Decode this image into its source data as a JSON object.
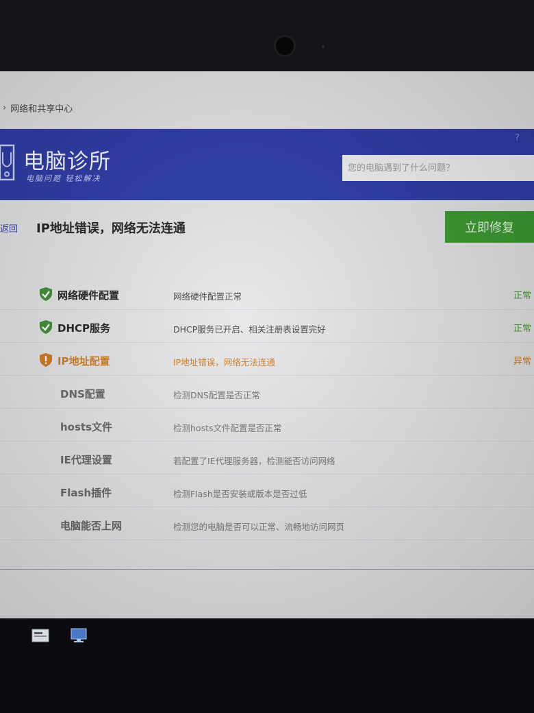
{
  "breadcrumb": {
    "chevron": "›",
    "current": "网络和共享中心"
  },
  "header": {
    "app_name": "电脑诊所",
    "slogan": "电脑问题 轻松解决",
    "search_placeholder": "您的电脑遇到了什么问题？",
    "help_mark": "?",
    "brand_color": "#2b3aa8"
  },
  "issue": {
    "back_label": "返回",
    "title": "IP地址错误，网络无法连通",
    "fix_button": "立即修复",
    "fix_color": "#3a9a2e"
  },
  "checks": [
    {
      "name": "网络硬件配置",
      "desc": "网络硬件配置正常",
      "status": "正常",
      "icon": "shield-check-icon"
    },
    {
      "name": "DHCP服务",
      "desc": "DHCP服务已开启、相关注册表设置完好",
      "status": "正常",
      "icon": "shield-check-icon"
    },
    {
      "name": "IP地址配置",
      "desc": "IP地址错误，网络无法连通",
      "status": "异常",
      "icon": "shield-warning-icon"
    },
    {
      "name": "DNS配置",
      "desc": "检测DNS配置是否正常",
      "status": ""
    },
    {
      "name": "hosts文件",
      "desc": "检测hosts文件配置是否正常",
      "status": ""
    },
    {
      "name": "IE代理设置",
      "desc": "若配置了IE代理服务器，检测能否访问网络",
      "status": ""
    },
    {
      "name": "Flash插件",
      "desc": "检测Flash是否安装或版本是否过低",
      "status": ""
    },
    {
      "name": "电脑能否上网",
      "desc": "检测您的电脑是否可以正常、流畅地访问网页",
      "status": ""
    }
  ],
  "colors": {
    "ok": "#4b9a3a",
    "warn": "#d27a1e"
  }
}
